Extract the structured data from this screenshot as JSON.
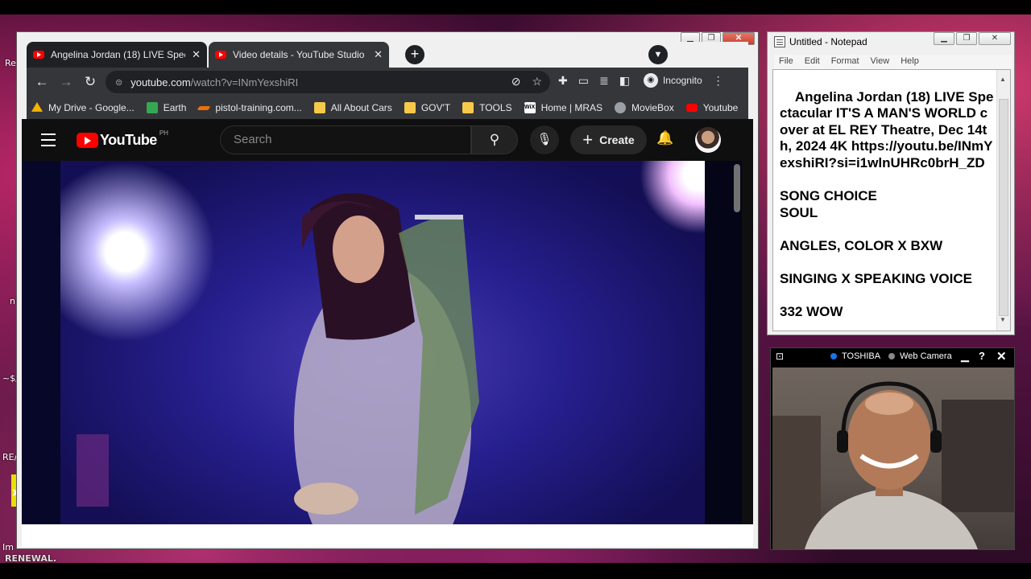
{
  "desktop": {
    "left_labels": [
      "Re",
      "n",
      "~$/",
      "RE/",
      "Im"
    ],
    "bottom_text": "RENEWAL."
  },
  "chrome": {
    "tabs": [
      {
        "title": "Angelina Jordan (18) LIVE Specta",
        "active": true
      },
      {
        "title": "Video details - YouTube Studio",
        "active": false
      }
    ],
    "url_host": "youtube.com",
    "url_rest": "/watch?v=INmYexshiRI",
    "profile_label": "Incognito",
    "bookmarks": [
      {
        "label": "My Drive - Google...",
        "icon": "drive-icon",
        "color": "#f4b400"
      },
      {
        "label": "Earth",
        "icon": "earth-icon",
        "color": "#34a853"
      },
      {
        "label": "pistol-training.com...",
        "icon": "pistol-icon",
        "color": "#e8710a"
      },
      {
        "label": "All About Cars",
        "icon": "folder-icon",
        "color": "#f6c94a"
      },
      {
        "label": "GOV'T",
        "icon": "folder-icon",
        "color": "#f6c94a"
      },
      {
        "label": "TOOLS",
        "icon": "folder-icon",
        "color": "#f6c94a"
      },
      {
        "label": "Home | MRAS",
        "icon": "wix-icon",
        "color": "#ffffff"
      },
      {
        "label": "MovieBox",
        "icon": "globe-icon",
        "color": "#9aa0a6"
      },
      {
        "label": "Youtube",
        "icon": "youtube-icon",
        "color": "#ff0000"
      }
    ]
  },
  "youtube": {
    "logo_word": "YouTube",
    "country_code": "PH",
    "search_placeholder": "Search",
    "create_label": "Create"
  },
  "notepad": {
    "title": "Untitled - Notepad",
    "menu": [
      "File",
      "Edit",
      "Format",
      "View",
      "Help"
    ],
    "content": "Angelina Jordan (18) LIVE Spectacular IT'S A MAN'S WORLD cover at EL REY Theatre, Dec 14th, 2024 4K https://youtu.be/INmYexshiRI?si=i1wlnUHRc0brH_ZD\n\nSONG CHOICE\nSOUL\n\nANGLES, COLOR X BXW\n\nSINGING X SPEAKING VOICE\n\n332 WOW"
  },
  "webcam": {
    "device": "TOSHIBA",
    "label": "Web Camera"
  },
  "colors": {
    "youtube_red": "#ff0000",
    "chrome_dark": "#202124",
    "chrome_toolbar": "#35363a"
  }
}
